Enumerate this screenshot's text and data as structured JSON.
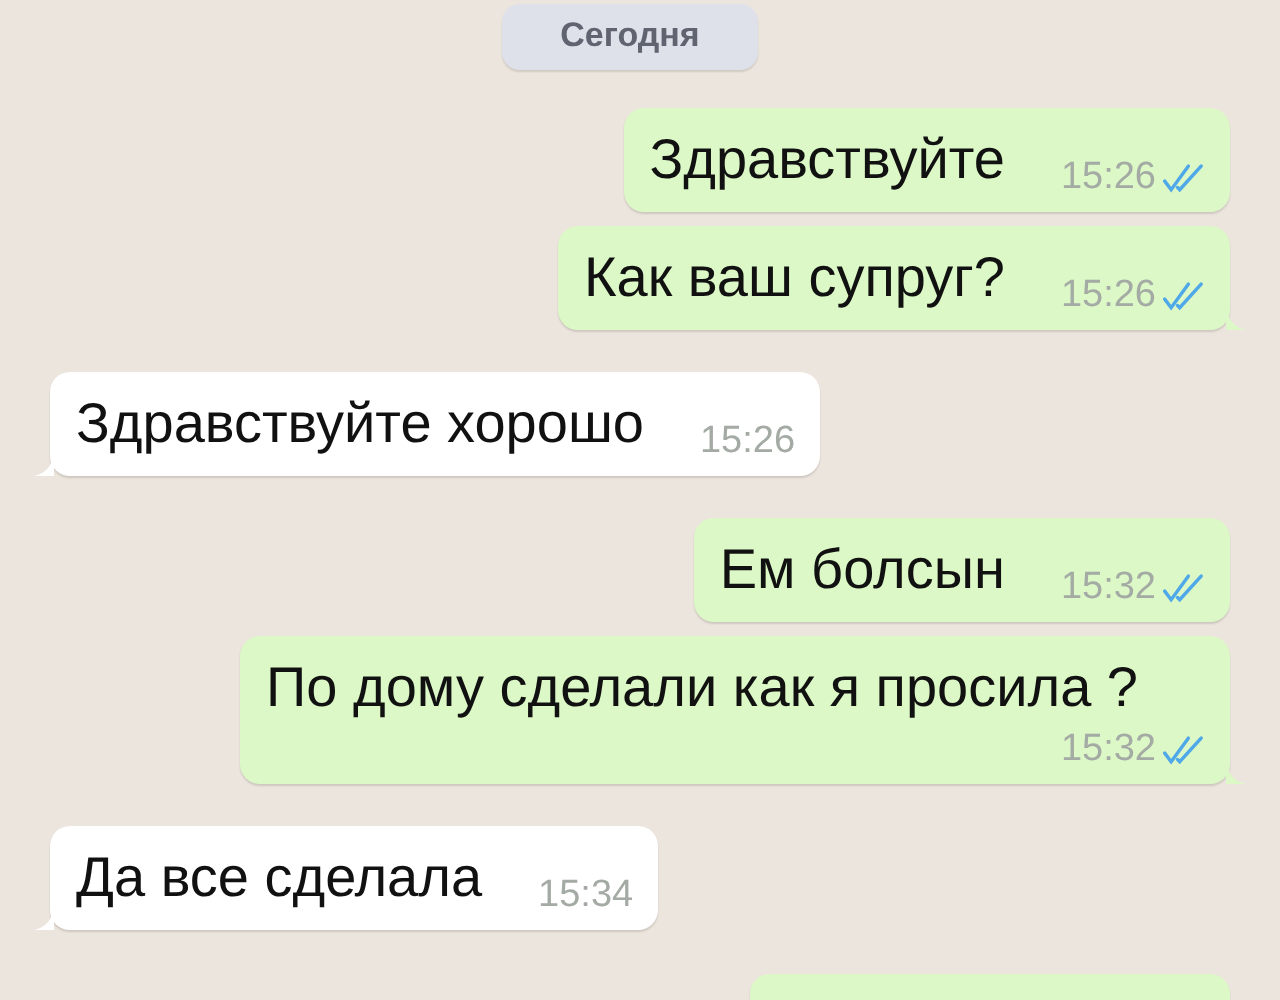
{
  "date_label": "Сегодня",
  "messages": [
    {
      "kind": "outgoing",
      "text": "Здравствуйте",
      "time": "15:26",
      "read": true,
      "tail": false
    },
    {
      "kind": "outgoing",
      "text": "Как ваш супруг?",
      "time": "15:26",
      "read": true,
      "tail": true
    },
    {
      "kind": "incoming",
      "text": "Здравствуйте хорошо",
      "time": "15:26",
      "tail": true
    },
    {
      "kind": "outgoing",
      "text": "Ем болсын",
      "time": "15:32",
      "read": true,
      "tail": false
    },
    {
      "kind": "outgoing",
      "text": "По дому сделали как я просила ?",
      "time": "15:32",
      "read": true,
      "tail": true
    },
    {
      "kind": "incoming",
      "text": "Да все сделала",
      "time": "15:34",
      "tail": true
    },
    {
      "kind": "cut-off-outgoing"
    }
  ]
}
